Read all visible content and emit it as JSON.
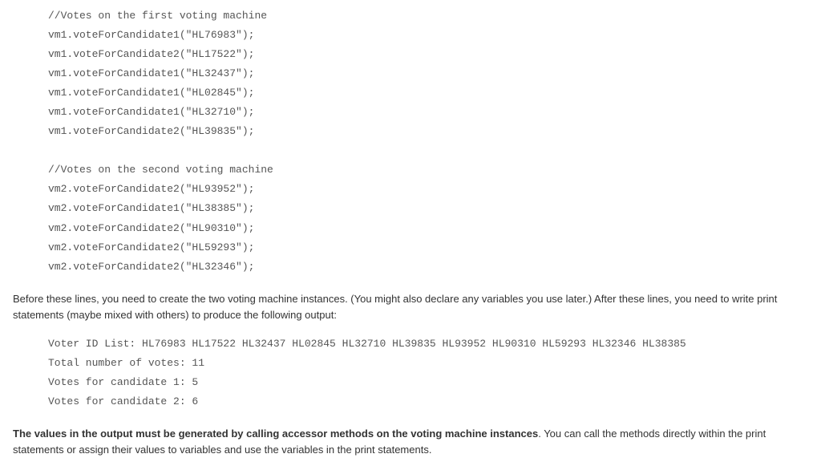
{
  "code": {
    "comment1": "//Votes on the first voting machine",
    "lines1": [
      "vm1.voteForCandidate1(\"HL76983\");",
      "vm1.voteForCandidate2(\"HL17522\");",
      "vm1.voteForCandidate1(\"HL32437\");",
      "vm1.voteForCandidate1(\"HL02845\");",
      "vm1.voteForCandidate1(\"HL32710\");",
      "vm1.voteForCandidate2(\"HL39835\");"
    ],
    "comment2": "//Votes on the second voting machine",
    "lines2": [
      "vm2.voteForCandidate2(\"HL93952\");",
      "vm2.voteForCandidate1(\"HL38385\");",
      "vm2.voteForCandidate2(\"HL90310\");",
      "vm2.voteForCandidate2(\"HL59293\");",
      "vm2.voteForCandidate2(\"HL32346\");"
    ]
  },
  "prose1": "Before these lines, you need to create the two voting machine instances. (You might also declare any variables you use later.) After these lines, you need to write print statements (maybe mixed with others) to produce the following output:",
  "output": {
    "lines": [
      "Voter ID List: HL76983 HL17522 HL32437 HL02845 HL32710 HL39835 HL93952 HL90310 HL59293 HL32346 HL38385",
      "Total number of votes: 11",
      "Votes for candidate 1: 5",
      "Votes for candidate 2: 6"
    ]
  },
  "prose2_bold": "The values in the output must be generated by calling accessor methods on the voting machine instances",
  "prose2_rest": ". You can call the methods directly within the print statements or assign their values to variables and use the variables in the print statements."
}
